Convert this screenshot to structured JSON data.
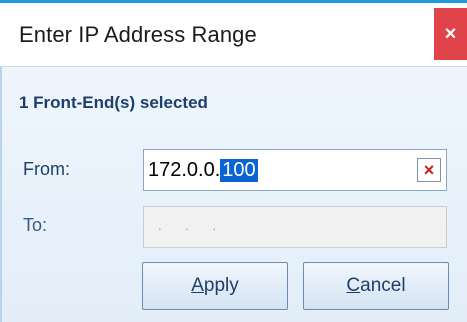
{
  "window": {
    "title": "Enter IP Address Range",
    "close_glyph": "×"
  },
  "summary": {
    "selected_text": "1 Front-End(s) selected"
  },
  "form": {
    "from_label": "From:",
    "from_value_prefix": "172.0.0.",
    "from_value_selected": "100",
    "clear_glyph": "×",
    "to_label": "To:",
    "to_placeholder": ". . ."
  },
  "buttons": {
    "apply_mnemonic": "A",
    "apply_rest": "pply",
    "cancel_mnemonic": "C",
    "cancel_rest": "ancel"
  },
  "colors": {
    "accent": "#1e9ae0",
    "close": "#e0444a",
    "selection": "#0b63d3"
  }
}
